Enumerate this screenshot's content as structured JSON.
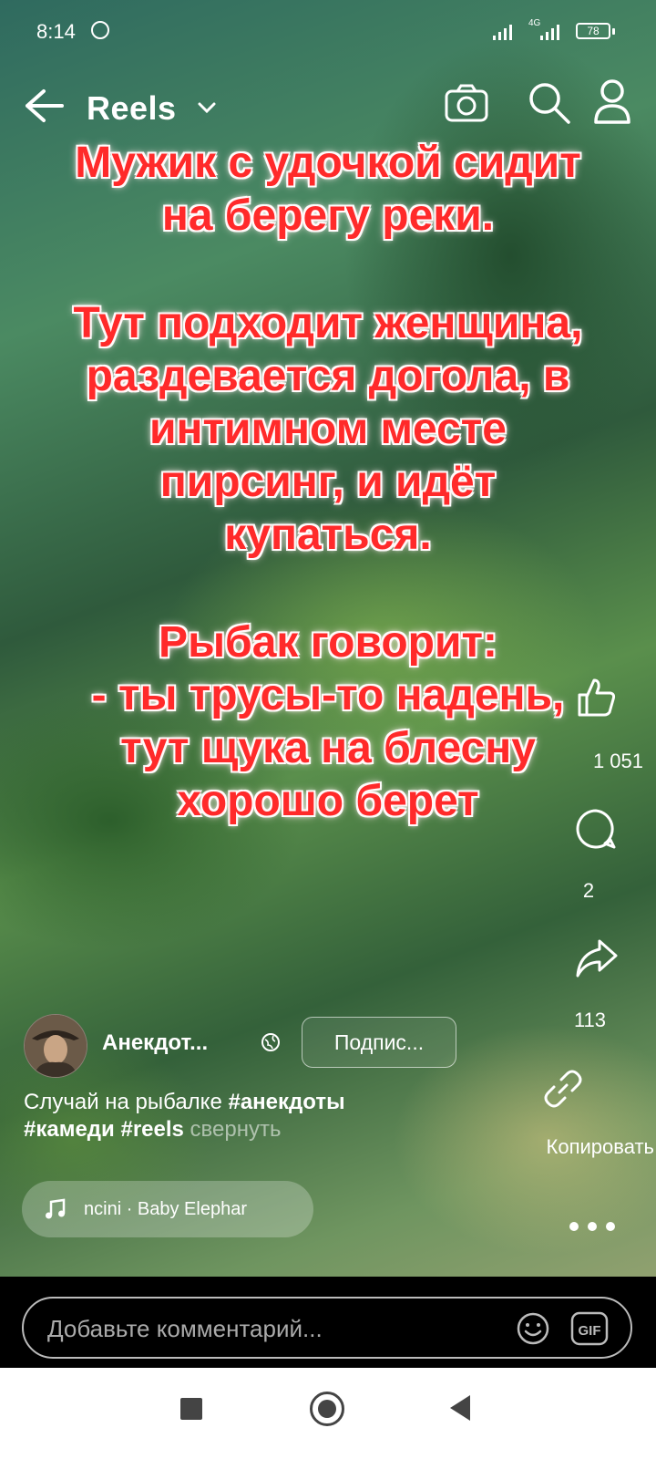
{
  "status_bar": {
    "time": "8:14",
    "network": "4G",
    "battery": "78"
  },
  "header": {
    "title": "Reels"
  },
  "overlay_text": {
    "line1": "Мужик с удочкой сидит",
    "line2": "на берегу реки.",
    "line3": "Тут подходит женщина,",
    "line4": "раздевается догола, в",
    "line5": "интимном месте",
    "line6": "пирсинг, и идёт",
    "line7": "купаться.",
    "line8": "Рыбак говорит:",
    "line9": "- ты трусы-то надень,",
    "line10": "тут щука на блесну",
    "line11": "хорошо берет"
  },
  "actions": {
    "likes": "1 051",
    "comments": "2",
    "shares": "113",
    "copy_label": "Копировать"
  },
  "author": {
    "name": "Анекдот...",
    "subscribe_label": "Подпис..."
  },
  "caption": {
    "text": "Случай на рыбалке",
    "tag1": "#анекдоты",
    "tag2": "#камеди",
    "tag3": "#reels",
    "collapse": "свернуть"
  },
  "music": {
    "track": "ncini · Baby Elephar"
  },
  "comment_box": {
    "placeholder": "Добавьте комментарий..."
  },
  "colors": {
    "overlay_text": "#ff2a2a",
    "accent": "#ffffff"
  }
}
